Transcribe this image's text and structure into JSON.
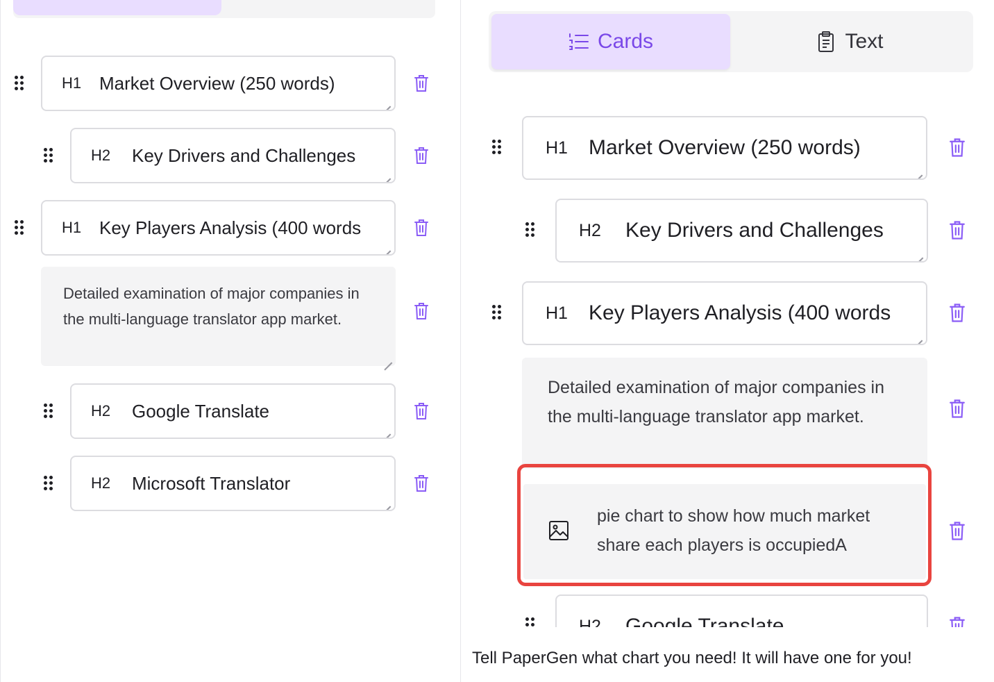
{
  "outline": {
    "items": [
      {
        "level": "H1",
        "title": "Market Overview (250 words)"
      },
      {
        "level": "H2",
        "title": "Key Drivers and Challenges"
      },
      {
        "level": "H1",
        "title": "Key Players Analysis (400 words"
      },
      {
        "type": "description",
        "text": "Detailed examination of major companies in the multi-language translator app market."
      },
      {
        "level": "H2",
        "title": "Google Translate"
      },
      {
        "level": "H2",
        "title": "Microsoft Translator"
      }
    ]
  },
  "view_toggle": {
    "cards_label": "Cards",
    "text_label": "Text",
    "selected": "Cards"
  },
  "image_prompt": {
    "text": "pie chart to show how much market share each players is occupiedA"
  },
  "caption": "Tell PaperGen what chart you need! It will have one for you!",
  "colors": {
    "accent": "#7a48e8",
    "accent_bg": "#e9ddff",
    "highlight": "#e9443f",
    "trash": "#8a5cf6"
  },
  "icons": {
    "drag": "drag-handle-icon",
    "delete": "trash-icon",
    "resize": "resize-grip-icon",
    "cards": "list-icon",
    "text": "clipboard-icon",
    "image": "image-icon"
  }
}
